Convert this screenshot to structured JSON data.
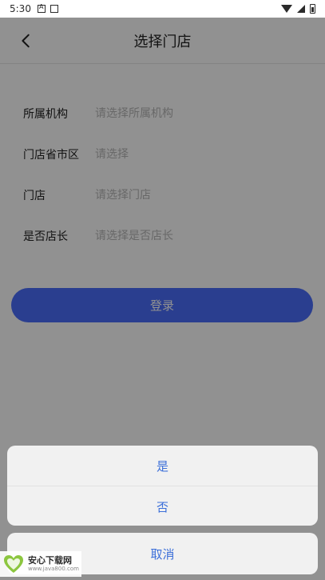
{
  "status_bar": {
    "time": "5:30"
  },
  "header": {
    "title": "选择门店"
  },
  "form": {
    "rows": [
      {
        "label": "所属机构",
        "placeholder": "请选择所属机构",
        "value": ""
      },
      {
        "label": "门店省市区",
        "placeholder": "请选择",
        "value": ""
      },
      {
        "label": "门店",
        "placeholder": "请选择门店",
        "value": ""
      },
      {
        "label": "是否店长",
        "placeholder": "请选择是否店长",
        "value": ""
      }
    ],
    "submit_label": "登录"
  },
  "action_sheet": {
    "options": [
      "是",
      "否"
    ],
    "cancel_label": "取消"
  },
  "watermark": {
    "title": "安心下载网",
    "url": "www.java800.com"
  },
  "colors": {
    "accent": "#4a6dfc",
    "sheet_text": "#3c6fd9",
    "overlay": "rgba(0,0,0,0.43)"
  },
  "icons": {
    "back": "chevron-left-icon",
    "wifi": "wifi-icon",
    "signal": "signal-icon",
    "battery": "battery-icon"
  }
}
